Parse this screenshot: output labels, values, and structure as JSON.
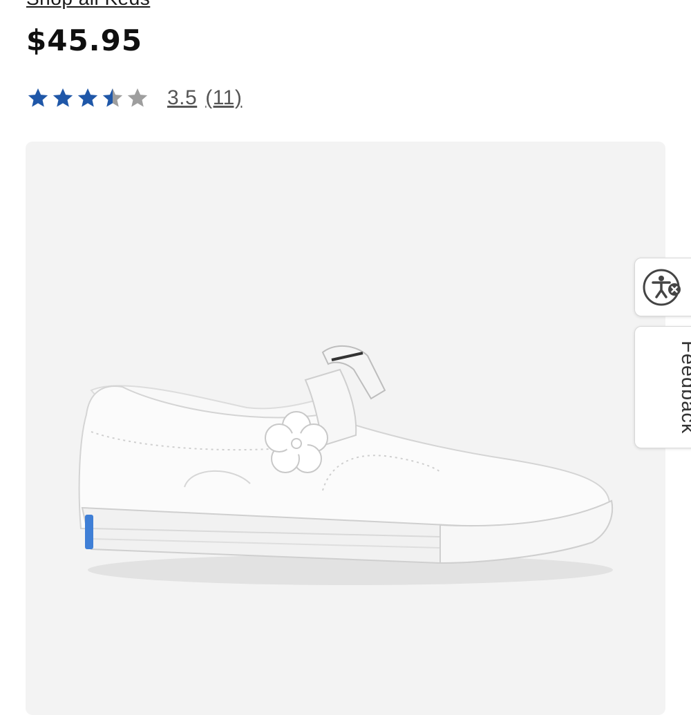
{
  "product": {
    "shop_link": "Shop all Keds",
    "price": "$45.95",
    "rating": {
      "value": 3.5,
      "max": 5,
      "value_label": "3.5",
      "count_label": "(11)"
    },
    "image": {
      "alt": "White leather T-strap sneaker with flower appliqué"
    }
  },
  "side_widgets": {
    "accessibility_icon": "accessibility-icon",
    "feedback_label": "Feedback"
  },
  "colors": {
    "star_filled": "#1f57a8",
    "star_empty": "#9e9e9e",
    "image_bg": "#f3f3f3",
    "keds_blue": "#3f7fd6"
  }
}
